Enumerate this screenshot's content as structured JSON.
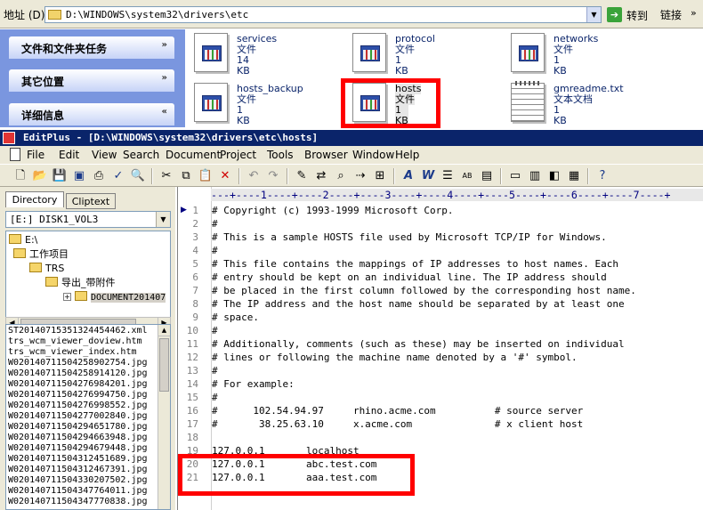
{
  "address_bar": {
    "label": "地址 (D)",
    "path": "D:\\WINDOWS\\system32\\drivers\\etc",
    "go_label": "转到",
    "links_label": "链接"
  },
  "task_pane": {
    "tasks": [
      {
        "label": "文件和文件夹任务",
        "chevron": "»"
      },
      {
        "label": "其它位置",
        "chevron": "»"
      },
      {
        "label": "详细信息",
        "chevron": "«"
      }
    ]
  },
  "files": [
    {
      "name": "services",
      "type": "文件",
      "size": "14 KB"
    },
    {
      "name": "protocol",
      "type": "文件",
      "size": "1 KB"
    },
    {
      "name": "networks",
      "type": "文件",
      "size": "1 KB"
    },
    {
      "name": "hosts_backup",
      "type": "文件",
      "size": "1 KB"
    },
    {
      "name": "hosts",
      "type": "文件",
      "size": "1 KB"
    },
    {
      "name": "gmreadme.txt",
      "type": "文本文档",
      "size": "1 KB"
    }
  ],
  "editplus": {
    "title": "EditPlus - [D:\\WINDOWS\\system32\\drivers\\etc\\hosts]",
    "menu": [
      "File",
      "Edit",
      "View",
      "Search",
      "Document",
      "Project",
      "Tools",
      "Browser",
      "Window",
      "Help"
    ],
    "tabs": [
      "Directory",
      "Cliptext"
    ],
    "drive": "[E:] DISK1_VOL3",
    "tree": [
      {
        "label": "E:\\"
      },
      {
        "label": "工作项目"
      },
      {
        "label": "TRS"
      },
      {
        "label": "导出_带附件"
      },
      {
        "label": "DOCUMENT201407"
      }
    ],
    "file_list": [
      "ST20140715351324454462.xml",
      "trs_wcm_viewer_doview.htm",
      "trs_wcm_viewer_index.htm",
      "W020140711504258902754.jpg",
      "W020140711504258914120.jpg",
      "W020140711504276984201.jpg",
      "W020140711504276994750.jpg",
      "W020140711504276998552.jpg",
      "W020140711504277002840.jpg",
      "W020140711504294651780.jpg",
      "W020140711504294663948.jpg",
      "W020140711504294679448.jpg",
      "W020140711504312451689.jpg",
      "W020140711504312467391.jpg",
      "W020140711504330207502.jpg",
      "W020140711504347764011.jpg",
      "W020140711504347770838.jpg"
    ],
    "ruler": "---+----1----+----2----+----3----+----4----+----5----+----6----+----7----+",
    "lines": [
      {
        "n": "1",
        "text": "# Copyright (c) 1993-1999 Microsoft Corp."
      },
      {
        "n": "2",
        "text": "#"
      },
      {
        "n": "3",
        "text": "# This is a sample HOSTS file used by Microsoft TCP/IP for Windows."
      },
      {
        "n": "4",
        "text": "#"
      },
      {
        "n": "5",
        "text": "# This file contains the mappings of IP addresses to host names. Each"
      },
      {
        "n": "6",
        "text": "# entry should be kept on an individual line. The IP address should"
      },
      {
        "n": "7",
        "text": "# be placed in the first column followed by the corresponding host name."
      },
      {
        "n": "8",
        "text": "# The IP address and the host name should be separated by at least one"
      },
      {
        "n": "9",
        "text": "# space."
      },
      {
        "n": "10",
        "text": "#"
      },
      {
        "n": "11",
        "text": "# Additionally, comments (such as these) may be inserted on individual"
      },
      {
        "n": "12",
        "text": "# lines or following the machine name denoted by a '#' symbol."
      },
      {
        "n": "13",
        "text": "#"
      },
      {
        "n": "14",
        "text": "# For example:"
      },
      {
        "n": "15",
        "text": "#"
      },
      {
        "n": "16",
        "text": "#      102.54.94.97     rhino.acme.com          # source server"
      },
      {
        "n": "17",
        "text": "#       38.25.63.10     x.acme.com              # x client host"
      },
      {
        "n": "18",
        "text": ""
      },
      {
        "n": "19",
        "text": "127.0.0.1       localhost"
      },
      {
        "n": "20",
        "text": "127.0.0.1       abc.test.com"
      },
      {
        "n": "21",
        "text": "127.0.0.1       aaa.test.com"
      }
    ]
  }
}
